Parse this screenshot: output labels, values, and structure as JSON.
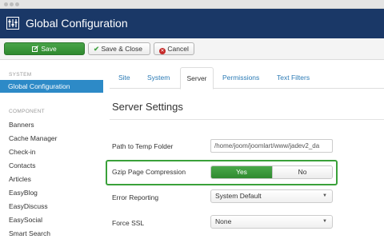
{
  "header": {
    "title": "Global Configuration"
  },
  "toolbar": {
    "save_label": "Save",
    "save_close_label": "Save & Close",
    "cancel_label": "Cancel"
  },
  "sidebar": {
    "system_heading": "SYSTEM",
    "active_item": "Global Configuration",
    "component_heading": "COMPONENT",
    "items": [
      "Banners",
      "Cache Manager",
      "Check-in",
      "Contacts",
      "Articles",
      "EasyBlog",
      "EasyDiscuss",
      "EasySocial",
      "Smart Search"
    ]
  },
  "tabs": [
    {
      "label": "Site",
      "active": false
    },
    {
      "label": "System",
      "active": false
    },
    {
      "label": "Server",
      "active": true
    },
    {
      "label": "Permissions",
      "active": false
    },
    {
      "label": "Text Filters",
      "active": false
    }
  ],
  "main": {
    "section_title": "Server Settings",
    "temp_folder_label": "Path to Temp Folder",
    "temp_folder_value": "/home/joom/joomlart/www/jadev2_da",
    "gzip_label": "Gzip Page Compression",
    "gzip_yes": "Yes",
    "gzip_no": "No",
    "gzip_selected": "Yes",
    "error_label": "Error Reporting",
    "error_value": "System Default",
    "ssl_label": "Force SSL",
    "ssl_value": "None"
  },
  "colors": {
    "header_bg": "#1a3867",
    "save_green": "#3a963a",
    "active_blue": "#2d8ac7",
    "highlight_green": "#3aa13a",
    "link_blue": "#2a7ab5"
  },
  "icons": {
    "logo": "joomla-config-icon",
    "save": "edit-icon",
    "save_close": "check-icon",
    "cancel": "cancel-icon",
    "select_caret": "caret-down-icon"
  }
}
